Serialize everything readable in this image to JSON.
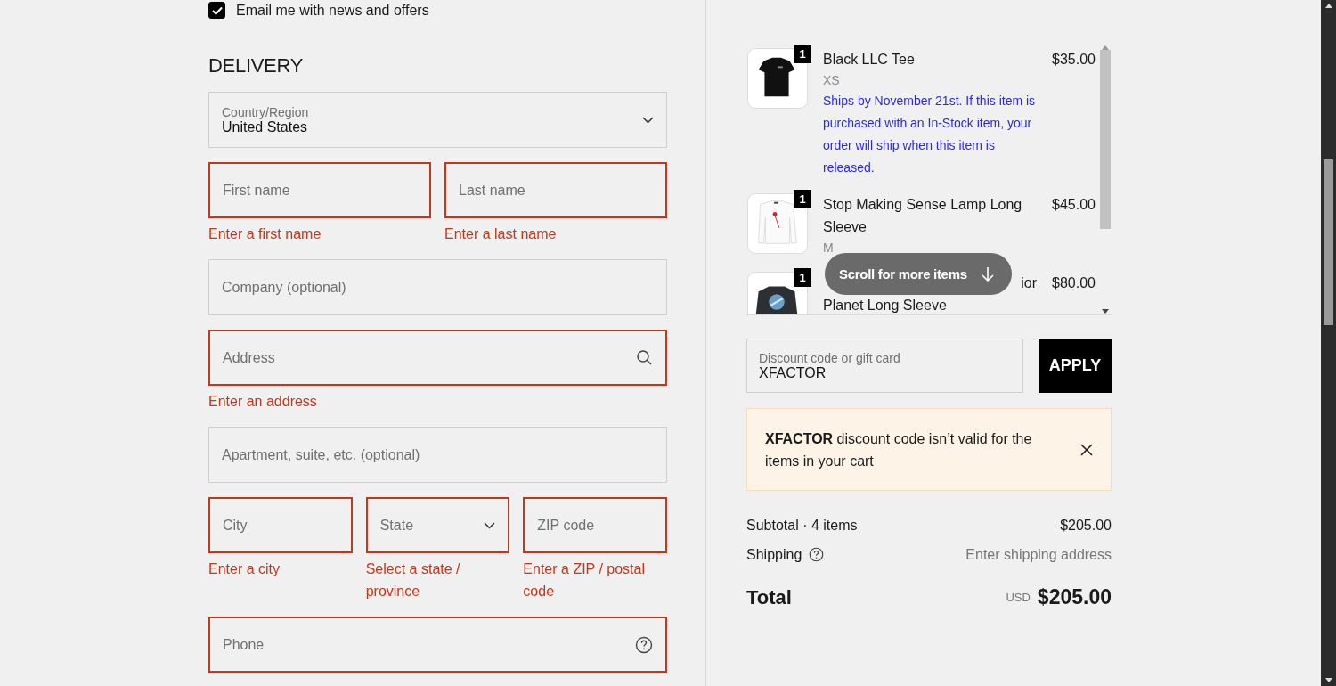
{
  "newsletter": {
    "label": "Email me with news and offers",
    "checked": true
  },
  "delivery": {
    "title": "DELIVERY",
    "rows": [
      [
        {
          "kind": "select",
          "label": "Country/Region",
          "value": "United States",
          "invalid": false
        }
      ],
      [
        {
          "kind": "text",
          "placeholder": "First name",
          "invalid": true,
          "error": "Enter a first name"
        },
        {
          "kind": "text",
          "placeholder": "Last name",
          "invalid": true,
          "error": "Enter a last name"
        }
      ],
      [
        {
          "kind": "text",
          "placeholder": "Company (optional)",
          "invalid": false
        }
      ],
      [
        {
          "kind": "search",
          "placeholder": "Address",
          "invalid": true,
          "error": "Enter an address"
        }
      ],
      [
        {
          "kind": "text",
          "placeholder": "Apartment, suite, etc. (optional)",
          "invalid": false
        }
      ],
      [
        {
          "kind": "text",
          "placeholder": "City",
          "invalid": true,
          "error": "Enter a city"
        },
        {
          "kind": "select",
          "placeholder": "State",
          "invalid": true,
          "error": "Select a state / province"
        },
        {
          "kind": "text",
          "placeholder": "ZIP code",
          "invalid": true,
          "error": "Enter a ZIP / postal code"
        }
      ],
      [
        {
          "kind": "help",
          "placeholder": "Phone",
          "invalid": true
        }
      ]
    ]
  },
  "cart": {
    "items": [
      {
        "kind": "tee",
        "quantity": "1",
        "title": [
          "Black LLC Tee"
        ],
        "variant": "XS",
        "note": "Ships by November 21st. If this item is purchased with an In-Stock item, your order will ship when this item is released.",
        "price": "$35.00"
      },
      {
        "kind": "lamp",
        "quantity": "1",
        "title": [
          "Stop Making Sense Lamp Long Sleeve"
        ],
        "variant": "M",
        "price": "$45.00"
      },
      {
        "kind": "planet",
        "quantity": "1",
        "title": [
          "ior",
          "Planet Long Sleeve"
        ],
        "covered": true,
        "price": "$80.00"
      }
    ],
    "scroll_hint": "Scroll for more items"
  },
  "discount": {
    "label": "Discount code or gift card",
    "value": "XFACTOR",
    "button": "APPLY"
  },
  "alert": "**XFACTOR** discount code isn’t valid for the items in your cart",
  "summary": [
    {
      "kind": "line",
      "label": "Subtotal · 4 items",
      "value": "$205.00",
      "help": false
    },
    {
      "kind": "muted",
      "label": "Shipping",
      "value": "Enter shipping address",
      "help": true
    }
  ],
  "total": {
    "label": "Total",
    "currency": "USD",
    "value": "$205.00"
  }
}
